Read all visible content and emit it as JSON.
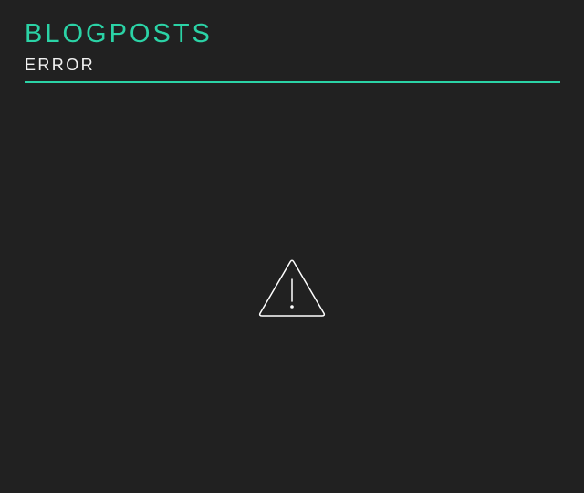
{
  "header": {
    "title": "BLOGPOSTS",
    "subtitle": "ERROR"
  },
  "main": {
    "status_icon": "warning-triangle-icon"
  },
  "colors": {
    "background": "#212121",
    "accent": "#2bd3a6",
    "text": "#f2f2f2",
    "icon_stroke": "#ffffff"
  }
}
